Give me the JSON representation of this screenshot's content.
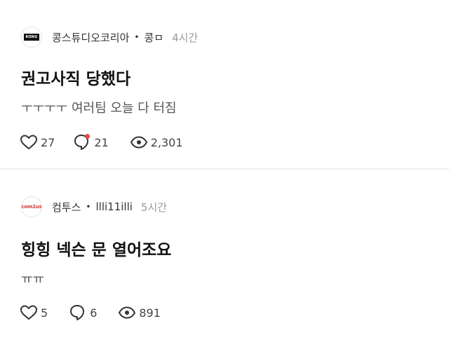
{
  "posts": [
    {
      "logo_text": "KONG",
      "company": "콩스튜디오코리아",
      "author": "콩ㅁ",
      "time": "4시간",
      "title": "권고사직 당했다",
      "body": "ㅜㅜㅜㅜ 여러팀 오늘 다 터짐",
      "likes": "27",
      "comments": "21",
      "views": "2,301",
      "has_new_comment": true
    },
    {
      "logo_text": "com2us",
      "company": "컴투스",
      "author": "llli11illi",
      "time": "5시간",
      "title": "힝힝 넥슨 문 열어조요",
      "body": "ㅠㅠ",
      "likes": "5",
      "comments": "6",
      "views": "891",
      "has_new_comment": false
    }
  ],
  "icons": {
    "like": "heart-icon",
    "comment": "speech-bubble-icon",
    "views": "eye-icon"
  },
  "colors": {
    "new_comment_dot": "#e8453c",
    "com2us_brand": "#d23a2e"
  }
}
